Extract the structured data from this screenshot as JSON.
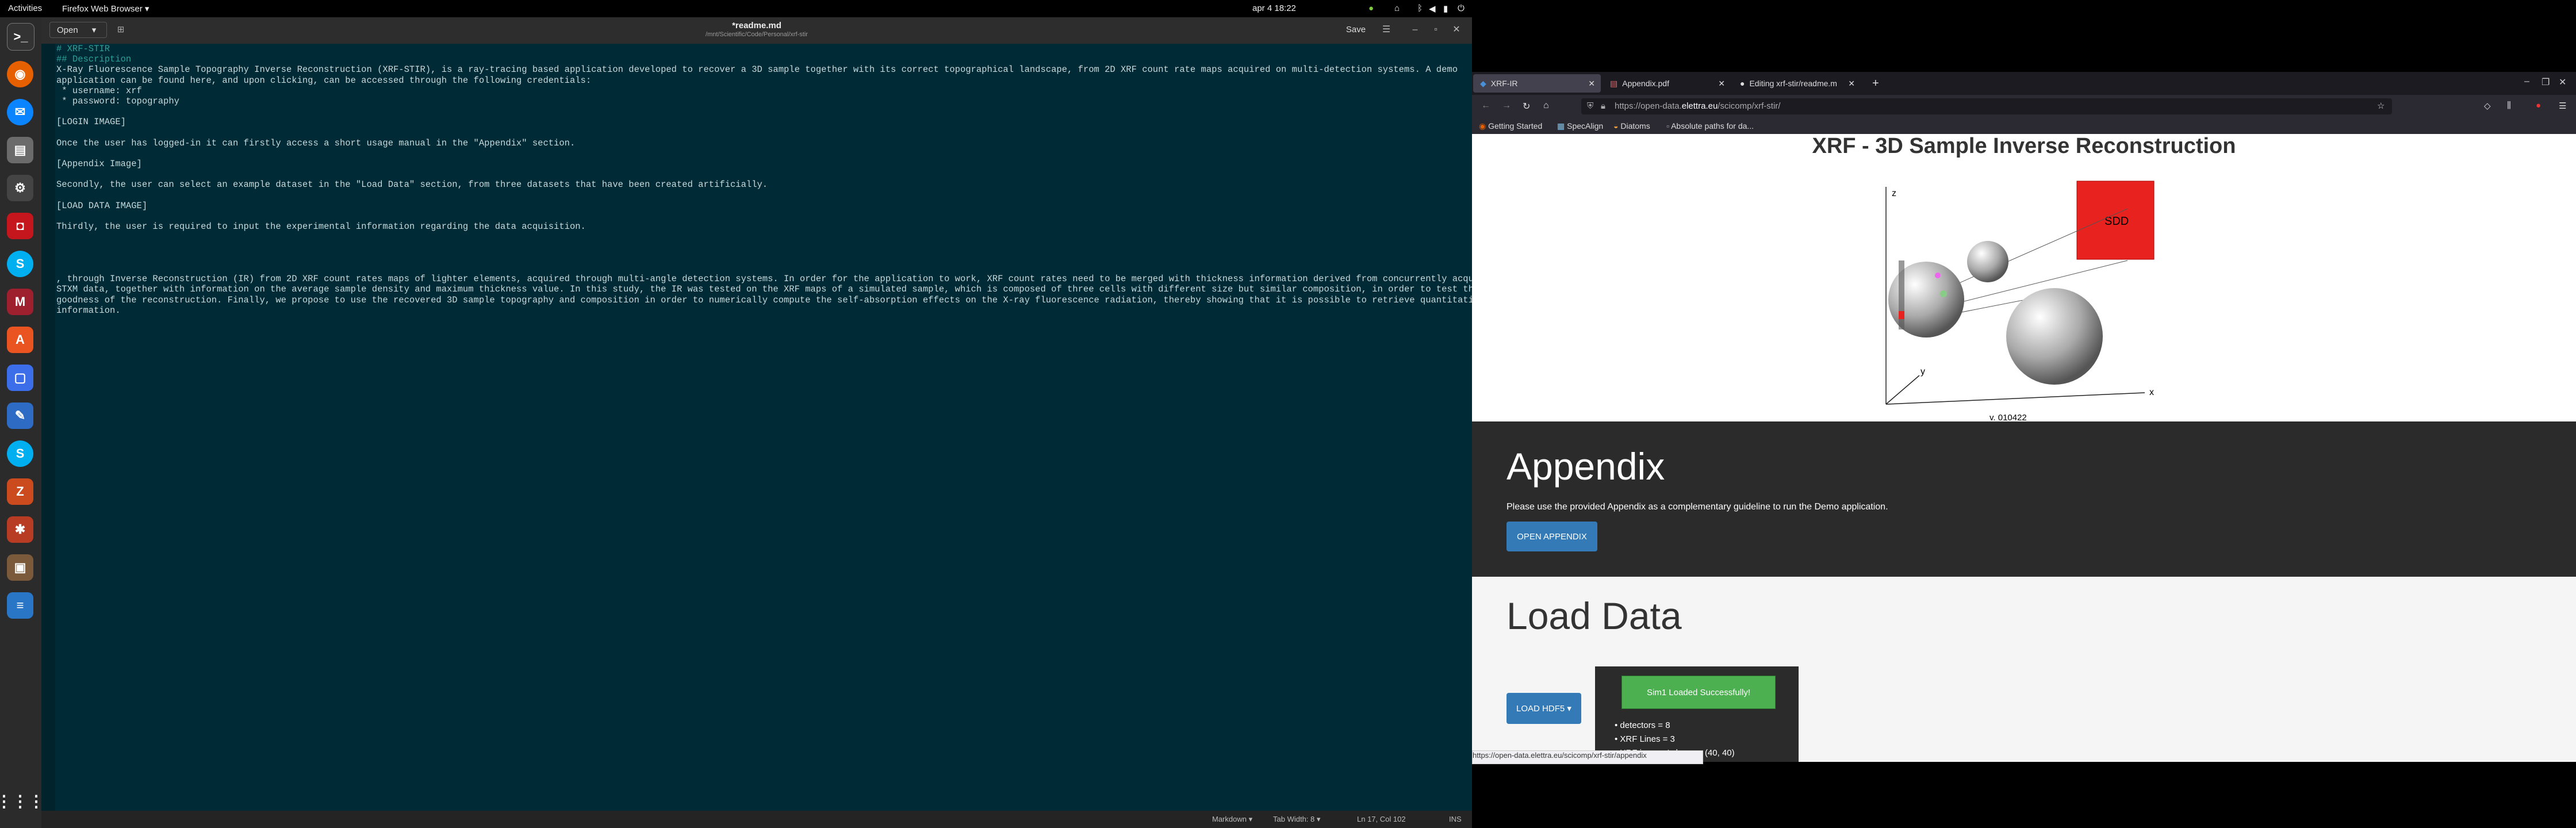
{
  "topbar": {
    "activities": "Activities",
    "app_menu": "Firefox Web Browser ▾",
    "clock": "apr 4  18:22"
  },
  "dock": {
    "icons": [
      "terminal-icon",
      "firefox-icon",
      "thunderbird-icon",
      "files-icon",
      "settings-icon",
      "app-icon",
      "skype-icon",
      "mendeley-icon",
      "software-icon",
      "screenshot-icon",
      "editor-icon",
      "skype2-icon",
      "zotero-icon",
      "inkscape-icon",
      "photo-icon",
      "document-icon",
      "apps-grid-icon"
    ]
  },
  "editor": {
    "open_label": "Open",
    "save_label": "Save",
    "title": "*readme.md",
    "subtitle": "/mnt/Scientific/Code/Personal/xrf-stir",
    "lines": [
      "# XRF-STIR",
      "## Description",
      "X-Ray Fluorescence Sample Topography Inverse Reconstruction (XRF-STIR), is a ray-tracing based application developed to recover a 3D sample together with its correct topographical landscape, from 2D XRF count rate maps acquired on multi-detection systems. A demo",
      "application can be found here, and upon clicking, can be accessed through the following credentials:",
      " * username: xrf",
      " * password: topography",
      "",
      "[LOGIN IMAGE]",
      "",
      "Once the user has logged-in it can firstly access a short usage manual in the \"Appendix\" section.",
      "",
      "[Appendix Image]",
      "",
      "Secondly, the user can select an example dataset in the \"Load Data\" section, from three datasets that have been created artificially.",
      "",
      "[LOAD DATA IMAGE]",
      "",
      "Thirdly, the user is required to input the experimental information regarding the data acquisition.",
      "",
      "",
      "",
      "",
      ", through Inverse Reconstruction (IR) from 2D XRF count rates maps of lighter elements, acquired through multi-angle detection systems. In order for the application to work, XRF count rates need to be merged with thickness information derived from concurrently acquired",
      "STXM data, together with information on the average sample density and maximum thickness value. In this study, the IR was tested on the XRF maps of a simulated sample, which is composed of three cells with different size but similar composition, in order to test the",
      "goodness of the reconstruction. Finally, we propose to use the recovered 3D sample topography and composition in order to numerically compute the self-absorption effects on the X-ray fluorescence radiation, thereby showing that it is possible to retrieve quantitative",
      "information."
    ],
    "status": {
      "mode": "Markdown ▾",
      "tab": "Tab Width: 8 ▾",
      "pos": "Ln 17, Col 102",
      "ins": "INS"
    }
  },
  "browser": {
    "tabs": [
      {
        "label": "XRF-IR",
        "active": true
      },
      {
        "label": "Appendix.pdf",
        "active": false
      },
      {
        "label": "Editing xrf-stir/readme.m",
        "active": false
      }
    ],
    "url_prefix": "https://open-data.",
    "url_domain": "elettra.eu",
    "url_suffix": "/scicomp/xrf-stir/",
    "bookmarks": [
      "Getting Started",
      "SpecAlign",
      "Diatoms",
      "Absolute paths for da..."
    ],
    "status_url": "https://open-data.elettra.eu/scicomp/xrf-stir/appendix"
  },
  "page": {
    "title": "XRF - 3D Sample Inverse Reconstruction",
    "figure": {
      "z": "z",
      "y": "y",
      "x": "x",
      "sdd": "SDD",
      "version": "v. 010422"
    },
    "appendix": {
      "heading": "Appendix",
      "text": "Please use the provided Appendix as a complementary guideline to run the Demo application.",
      "button": "OPEN APPENDIX"
    },
    "load": {
      "heading": "Load Data",
      "button": "LOAD HDF5 ▾",
      "success": "Sim1 Loaded Successfully!",
      "items": [
        "detectors = 8",
        "XRF Lines = 3",
        "XRF images' shape = (40, 40)"
      ]
    }
  }
}
